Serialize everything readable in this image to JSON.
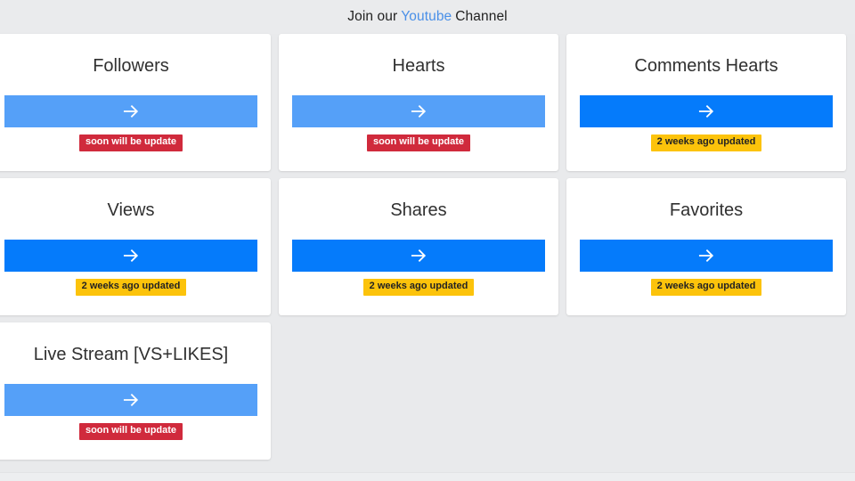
{
  "header": {
    "prefix": "Join our",
    "link_label": "Youtube",
    "suffix": "Channel",
    "link_color": "#4a90e8"
  },
  "colors": {
    "page_background": "#e9eaec",
    "card_background": "#ffffff",
    "button_light_blue": "#55a0f8",
    "button_strong_blue": "#057bfb",
    "badge_red": "#d02a3c",
    "badge_yellow": "#fcc30b"
  },
  "cards": [
    {
      "title": "Followers",
      "button_icon": "arrow-right-icon",
      "button_style": "light",
      "badge_label": "soon will be update",
      "badge_style": "red"
    },
    {
      "title": "Hearts",
      "button_icon": "arrow-right-icon",
      "button_style": "light",
      "badge_label": "soon will be update",
      "badge_style": "red"
    },
    {
      "title": "Comments Hearts",
      "button_icon": "arrow-right-icon",
      "button_style": "strong",
      "badge_label": "2 weeks ago updated",
      "badge_style": "yellow"
    },
    {
      "title": "Views",
      "button_icon": "arrow-right-icon",
      "button_style": "strong",
      "badge_label": "2 weeks ago updated",
      "badge_style": "yellow"
    },
    {
      "title": "Shares",
      "button_icon": "arrow-right-icon",
      "button_style": "strong",
      "badge_label": "2 weeks ago updated",
      "badge_style": "yellow"
    },
    {
      "title": "Favorites",
      "button_icon": "arrow-right-icon",
      "button_style": "strong",
      "badge_label": "2 weeks ago updated",
      "badge_style": "yellow"
    },
    {
      "title": "Live Stream [VS+LIKES]",
      "button_icon": "arrow-right-icon",
      "button_style": "light",
      "badge_label": "soon will be update",
      "badge_style": "red"
    }
  ]
}
